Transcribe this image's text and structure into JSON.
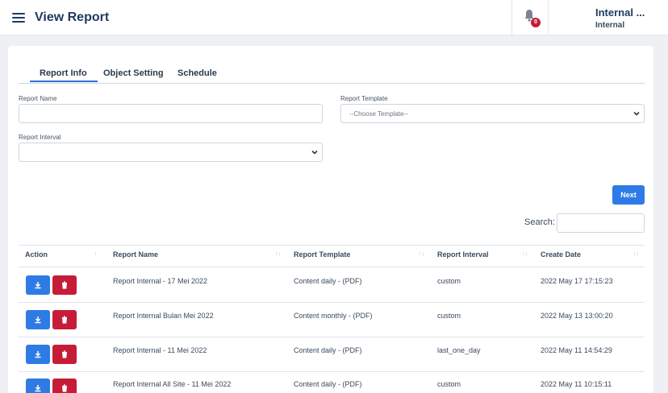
{
  "header": {
    "title": "View Report",
    "notification_count": "0",
    "user_name": "Internal ...",
    "user_role": "Internal"
  },
  "tabs": [
    {
      "label": "Report Info",
      "active": true
    },
    {
      "label": "Object Setting",
      "active": false
    },
    {
      "label": "Schedule",
      "active": false
    }
  ],
  "form": {
    "report_name_label": "Report Name",
    "report_name_value": "",
    "report_template_label": "Report Template",
    "report_template_value": "--Choose Template--",
    "report_interval_label": "Report Interval",
    "report_interval_value": ""
  },
  "next_label": "Next",
  "search_label": "Search:",
  "table": {
    "columns": [
      "Action",
      "Report Name",
      "Report Template",
      "Report Interval",
      "Create Date"
    ],
    "rows": [
      {
        "name": "Report Internal - 17 Mei 2022",
        "template": "Content daily - (PDF)",
        "interval": "custom",
        "date": "2022 May 17 17:15:23"
      },
      {
        "name": "Report Internal Bulan Mei 2022",
        "template": "Content monthly - (PDF)",
        "interval": "custom",
        "date": "2022 May 13 13:00:20"
      },
      {
        "name": "Report Internal - 11 Mei 2022",
        "template": "Content daily - (PDF)",
        "interval": "last_one_day",
        "date": "2022 May 11 14:54:29"
      },
      {
        "name": "Report Internal All Site - 11 Mei 2022",
        "template": "Content daily - (PDF)",
        "interval": "custom",
        "date": "2022 May 11 10:15:11"
      }
    ]
  },
  "colors": {
    "primary": "#2e7be6",
    "danger": "#c51d38",
    "title": "#1e3a5f"
  },
  "icons": {
    "menu": "hamburger-icon",
    "notifications": "bell-icon",
    "download": "download-icon",
    "delete": "trash-icon",
    "sort": "sort-icon",
    "dropdown": "chevron-down-icon"
  }
}
